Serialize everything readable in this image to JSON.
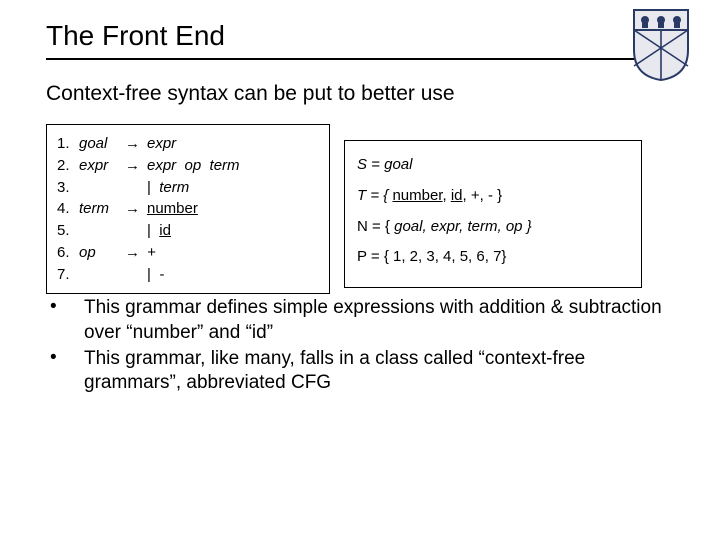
{
  "title": "The Front End",
  "subtitle": "Context-free syntax can be put to better use",
  "grammar": {
    "rows": [
      {
        "n": "1.",
        "lhs": "goal",
        "arrow": "→",
        "rhs": "expr"
      },
      {
        "n": "2.",
        "lhs": "expr",
        "arrow": "→",
        "rhs": "expr  op  term"
      },
      {
        "n": "3.",
        "lhs": "",
        "arrow": "",
        "rhs_bar": "|  ",
        "rhs": "term"
      },
      {
        "n": "4.",
        "lhs": "term",
        "arrow": "→",
        "rhs_ul": "number"
      },
      {
        "n": "5.",
        "lhs": "",
        "arrow": "",
        "rhs_bar": "|  ",
        "rhs_ul": "id"
      },
      {
        "n": "6.",
        "lhs": "op",
        "arrow": "→",
        "rhs": "+"
      },
      {
        "n": "7.",
        "lhs": "",
        "arrow": "",
        "rhs_bar": "|  ",
        "rhs": "-"
      }
    ]
  },
  "sets": {
    "S_lhs": "S = ",
    "S_rhs": "goal",
    "T_lhs": "T = { ",
    "T_items": [
      "number",
      ", ",
      "id",
      ", +, - }"
    ],
    "N_lhs": "N = { ",
    "N_rhs": "goal, expr, term, op }",
    "P_lhs": "P = { 1, 2, 3, 4, 5, 6, 7}"
  },
  "bullets": [
    "This grammar defines simple expressions with addition & subtraction over  “number” and “id”",
    "This grammar, like many, falls in a class called “context-free grammars”, abbreviated CFG"
  ]
}
